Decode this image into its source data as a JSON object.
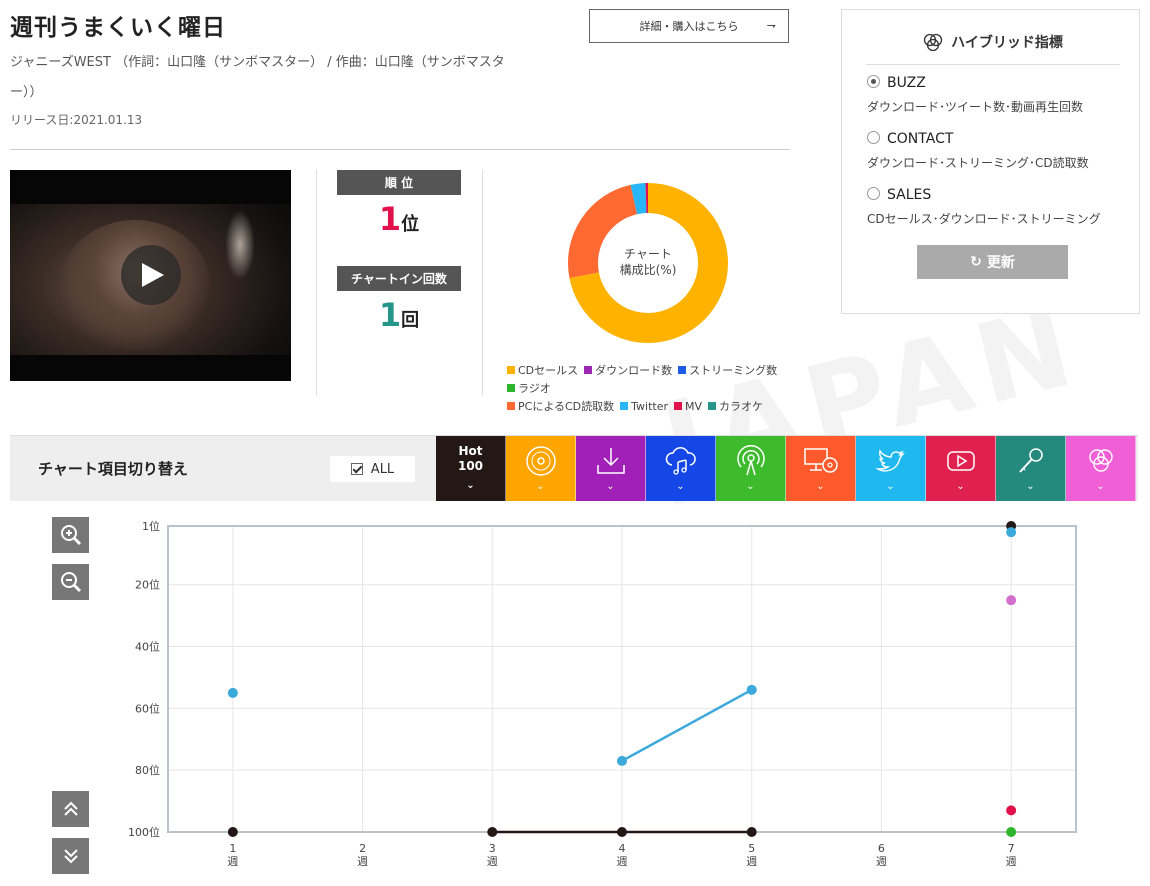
{
  "song": {
    "title": "週刊うまくいく曜日",
    "credits": "ジャニーズWEST （作詞：山口隆（サンボマスター） / 作曲：山口隆（サンボマスター））",
    "release": "リリース日:2021.01.13"
  },
  "buy_button": "詳細・購入はこちら",
  "stats": {
    "rank_label": "順 位",
    "rank_value": "1",
    "rank_unit": "位",
    "chartin_label": "チャートイン回数",
    "chartin_value": "1",
    "chartin_unit": "回"
  },
  "donut": {
    "center_line1": "チャート",
    "center_line2": "構成比(%)",
    "slices": [
      {
        "name": "CDセールス",
        "value": 72,
        "color": "#FFB300"
      },
      {
        "name": "PCによるCD読取数",
        "value": 24.5,
        "color": "#FF6A33"
      },
      {
        "name": "Twitter",
        "value": 3,
        "color": "#29B6F6"
      },
      {
        "name": "MV",
        "value": 0.5,
        "color": "#E0114C"
      }
    ],
    "legend": [
      {
        "name": "CDセールス",
        "color": "#FFB300"
      },
      {
        "name": "ダウンロード数",
        "color": "#9C27B0"
      },
      {
        "name": "ストリーミング数",
        "color": "#1E5BE8"
      },
      {
        "name": "ラジオ",
        "color": "#2DB52D"
      },
      {
        "name": "PCによるCD読取数",
        "color": "#FF6A33"
      },
      {
        "name": "Twitter",
        "color": "#29B6F6"
      },
      {
        "name": "MV",
        "color": "#E0114C"
      },
      {
        "name": "カラオケ",
        "color": "#26958A"
      }
    ]
  },
  "hybrid": {
    "title": "ハイブリッド指標",
    "options": [
      {
        "label": "BUZZ",
        "desc": "ダウンロード･ツイート数･動画再生回数",
        "selected": true
      },
      {
        "label": "CONTACT",
        "desc": "ダウンロード･ストリーミング･CD読取数",
        "selected": false
      },
      {
        "label": "SALES",
        "desc": "CDセールス･ダウンロード･ストリーミング",
        "selected": false
      }
    ],
    "update_label": "更新"
  },
  "switch": {
    "label": "チャート項目切り替え",
    "all_label": "ALL",
    "hot_line1": "Hot",
    "hot_line2": "100",
    "categories": [
      {
        "icon": "hot100-icon",
        "color": "#231815"
      },
      {
        "icon": "cd-icon",
        "color": "#FFA500"
      },
      {
        "icon": "download-icon",
        "color": "#A020B8"
      },
      {
        "icon": "cloud-music-icon",
        "color": "#1447E6"
      },
      {
        "icon": "radio-icon",
        "color": "#3DBB2C"
      },
      {
        "icon": "pc-cd-icon",
        "color": "#FF5A2C"
      },
      {
        "icon": "twitter-icon",
        "color": "#20B9EF"
      },
      {
        "icon": "youtube-icon",
        "color": "#E0214F"
      },
      {
        "icon": "karaoke-icon",
        "color": "#258A7E"
      },
      {
        "icon": "hybrid-icon",
        "color": "#F05FD6"
      }
    ]
  },
  "chart_data": {
    "type": "line",
    "x": [
      1,
      2,
      3,
      4,
      5,
      6,
      7
    ],
    "x_tick_labels": [
      "1\n週",
      "2\n週",
      "3\n週",
      "4\n週",
      "5\n週",
      "6\n週",
      "7\n週"
    ],
    "y_tick_labels": [
      "1位",
      "20位",
      "40位",
      "60位",
      "80位",
      "100位"
    ],
    "y_ticks": [
      1,
      20,
      40,
      60,
      80,
      100
    ],
    "ylim": [
      1,
      100
    ],
    "y_inverted": true,
    "grid": true,
    "series": [
      {
        "color": "#231815",
        "points": [
          [
            1,
            100
          ],
          [
            3,
            100
          ],
          [
            4,
            100
          ],
          [
            5,
            100
          ],
          [
            7,
            1
          ]
        ],
        "segments": [
          [
            3,
            4
          ],
          [
            4,
            5
          ]
        ]
      },
      {
        "color": "#3BA9DC",
        "points": [
          [
            1,
            55
          ],
          [
            4,
            77
          ],
          [
            5,
            54
          ],
          [
            7,
            3
          ]
        ],
        "segments": [
          [
            4,
            5
          ]
        ]
      },
      {
        "color": "#D56FCF",
        "points": [
          [
            7,
            25
          ]
        ],
        "segments": []
      },
      {
        "color": "#E0114C",
        "points": [
          [
            7,
            93
          ]
        ],
        "segments": []
      },
      {
        "color": "#2DB52D",
        "points": [
          [
            7,
            100
          ]
        ],
        "segments": []
      }
    ]
  },
  "watermark": "JAPAN"
}
